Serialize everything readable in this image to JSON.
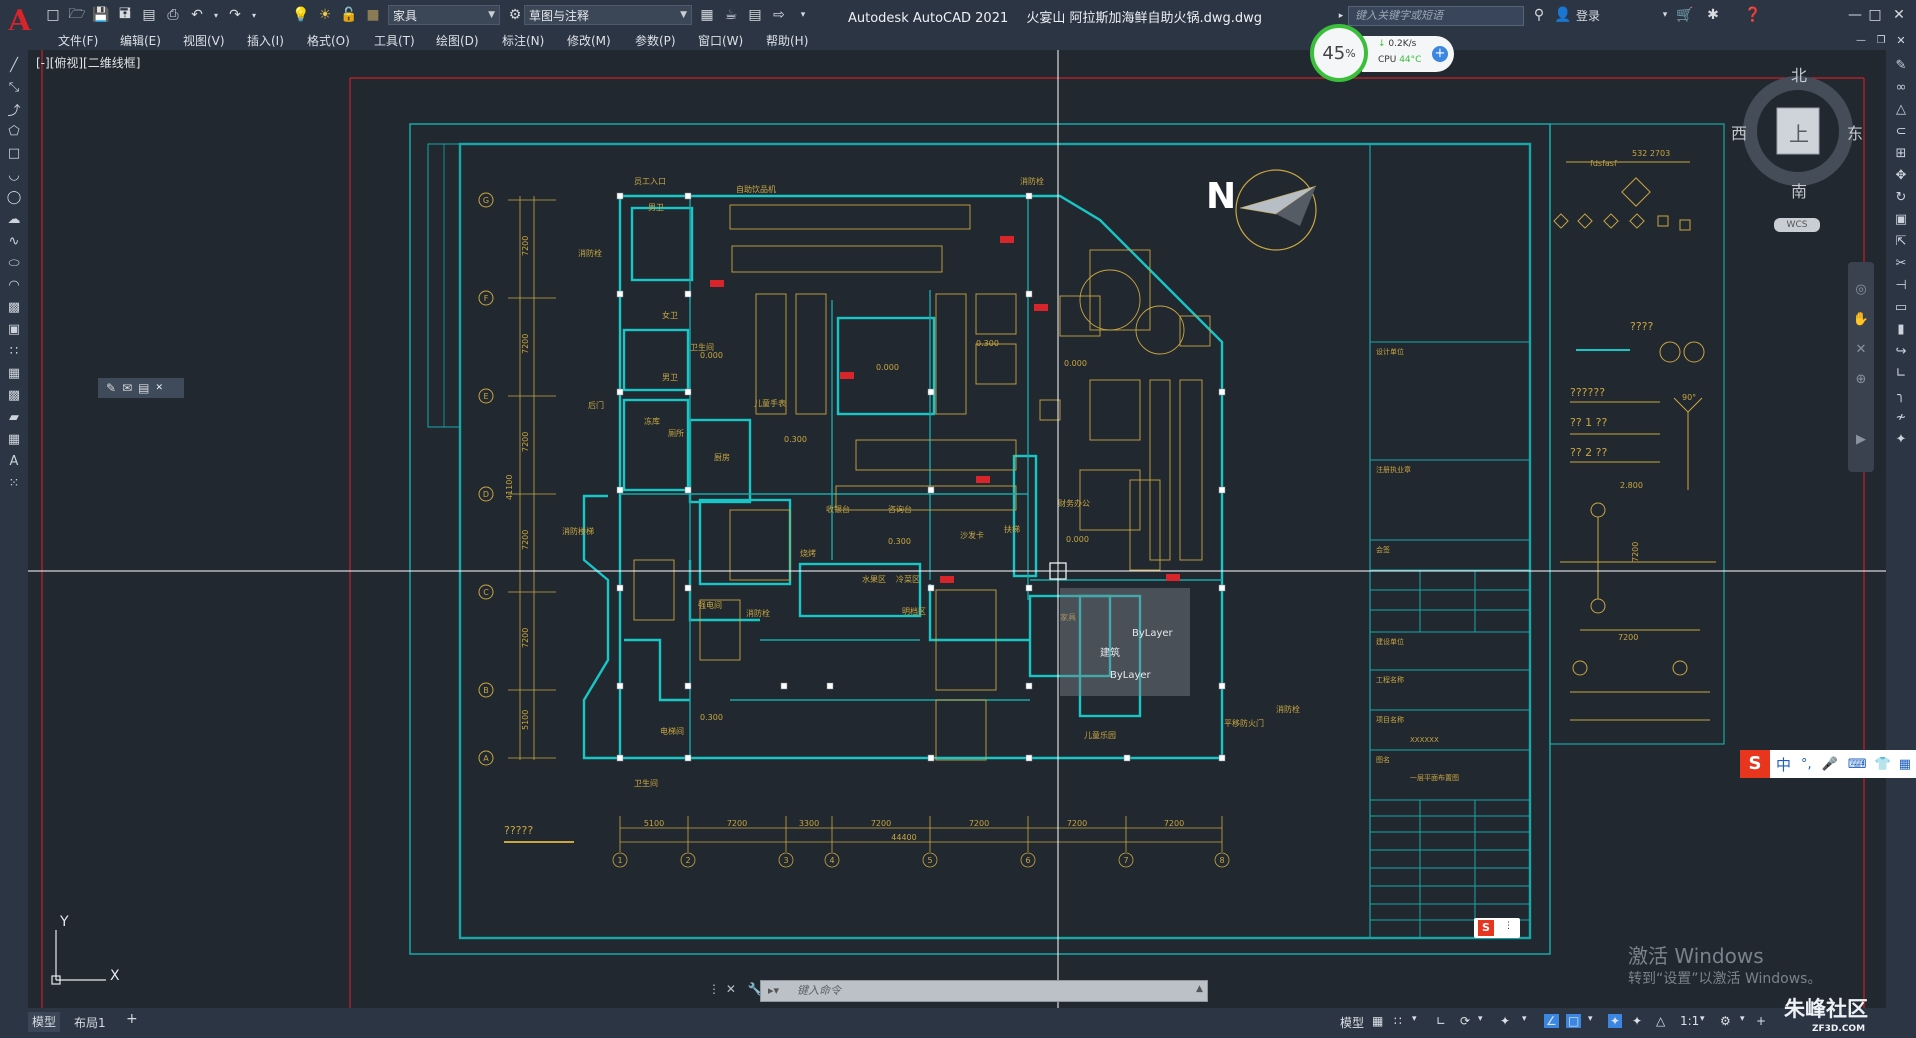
{
  "app": {
    "title": "Autodesk AutoCAD 2021",
    "file": "火宴山 阿拉斯加海鲜自助火锅.dwg.dwg",
    "logo": "A"
  },
  "quick_access": {
    "layer_combo": "家具",
    "workspace_combo": "草图与注释"
  },
  "search": {
    "placeholder": "键入关键字或短语"
  },
  "user": {
    "login_label": "登录"
  },
  "menus": [
    "文件(F)",
    "编辑(E)",
    "视图(V)",
    "插入(I)",
    "格式(O)",
    "工具(T)",
    "绘图(D)",
    "标注(N)",
    "修改(M)",
    "参数(P)",
    "窗口(W)",
    "帮助(H)"
  ],
  "viewport": {
    "label": "[-][俯视][二维线框]"
  },
  "compass": {
    "north": "北",
    "south": "南",
    "east": "东",
    "west": "西",
    "top": "上",
    "wcs": "WCS"
  },
  "perf": {
    "percent": "45",
    "percent_unit": "%",
    "net": "0.2K/s",
    "cpu_label": "CPU",
    "cpu_temp": "44°C"
  },
  "command": {
    "placeholder": "键入命令"
  },
  "layout_tabs": [
    "模型",
    "布局1"
  ],
  "status": {
    "model": "模型",
    "scale": "1:1"
  },
  "watermark": {
    "line1": "激活 Windows",
    "line2": "转到“设置”以激活 Windows。"
  },
  "site_watermark": "朱峰社区",
  "site_sub": "ZF3D.COM",
  "ime": {
    "zh": "中"
  },
  "drawing": {
    "north_label": "N",
    "grid_rows": [
      "G",
      "F",
      "E",
      "D",
      "C",
      "B",
      "A"
    ],
    "grid_cols": [
      "1",
      "2",
      "3",
      "4",
      "5",
      "6",
      "7",
      "8"
    ],
    "row_dims": [
      "7200",
      "7200",
      "7200",
      "7200",
      "7200",
      "5100"
    ],
    "col_dims": [
      "5100",
      "7200",
      "3300",
      "7200",
      "7200",
      "7200",
      "7200"
    ],
    "total_dim_h": "44400",
    "total_dim_v": "41100",
    "room_labels": [
      "员工入口",
      "自助饮品机",
      "消防栓",
      "消防栓",
      "男卫",
      "女卫",
      "卫生间",
      "男卫",
      "后门",
      "冻库",
      "厨房",
      "厕所",
      "儿童手表",
      "强电间",
      "消防栓",
      "明档区",
      "烧烤",
      "水果区",
      "冷菜区",
      "沙发卡",
      "财务办公",
      "扶梯",
      "收银台",
      "咨询台",
      "儿童乐园",
      "消防栓",
      "平移防火门",
      "消防楼梯",
      "电梯间",
      "卫生间",
      "家具"
    ],
    "levels": [
      "0.000",
      "0.300",
      "0.000",
      "0.300",
      "0.000",
      "0.300",
      "0.000",
      "0.300"
    ],
    "qprops": [
      "ByLayer",
      "建筑",
      "ByLayer"
    ],
    "legend_text": [
      "fdsfasf",
      "532 2703",
      "????",
      "??????",
      "?? 1 ??",
      "?? 2 ??",
      "90°",
      "2.800",
      "7200",
      "7200"
    ],
    "titleblock": [
      "设计单位",
      "注册执业章",
      "会签",
      "建设单位",
      "工程名称",
      "项目名称",
      "XXXXXX",
      "图名",
      "一层平面布置图"
    ],
    "left_label": "?????"
  }
}
